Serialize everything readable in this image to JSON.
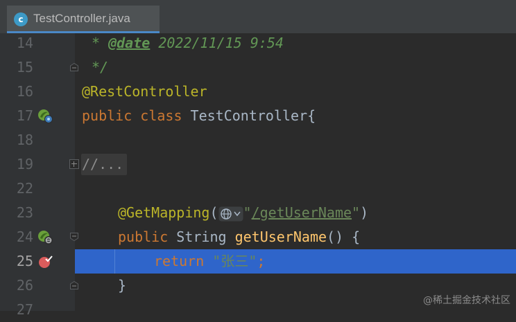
{
  "tab": {
    "label": "TestController.java",
    "icon": "java-class-icon",
    "icon_letter": "c"
  },
  "lines": [
    {
      "num": "14",
      "c1": "* ",
      "c2": "@date",
      "c3": " 2022/11/15 9:54"
    },
    {
      "num": "15",
      "c1": "*/"
    },
    {
      "num": "16",
      "c1": "@RestController"
    },
    {
      "num": "17",
      "kw1": "public",
      "kw2": "class",
      "rest": " TestController{"
    },
    {
      "num": "18"
    },
    {
      "num": "19",
      "folded": "//..."
    },
    {
      "num": "22"
    },
    {
      "num": "23",
      "ann": "@GetMapping",
      "p1": "(",
      "q1": "\"",
      "link": "/getUserName",
      "q2": "\"",
      "p2": ")"
    },
    {
      "num": "24",
      "kw": "public",
      "t": " String ",
      "fn": "getUserName",
      "rest": "() {"
    },
    {
      "num": "25",
      "kw": "return",
      "str": "\"张三\"",
      "semi": ";"
    },
    {
      "num": "26",
      "c1": "}"
    },
    {
      "num": "27"
    }
  ],
  "watermark": "@稀土掘金技术社区",
  "colors": {
    "background": "#2b2b2b",
    "gutter": "#313335",
    "highlight_line": "#2f65ca",
    "keyword": "#cc7832",
    "annotation": "#bbb529",
    "string": "#6a8759",
    "comment": "#629755",
    "method": "#ffc66d",
    "text": "#a9b7c6"
  }
}
